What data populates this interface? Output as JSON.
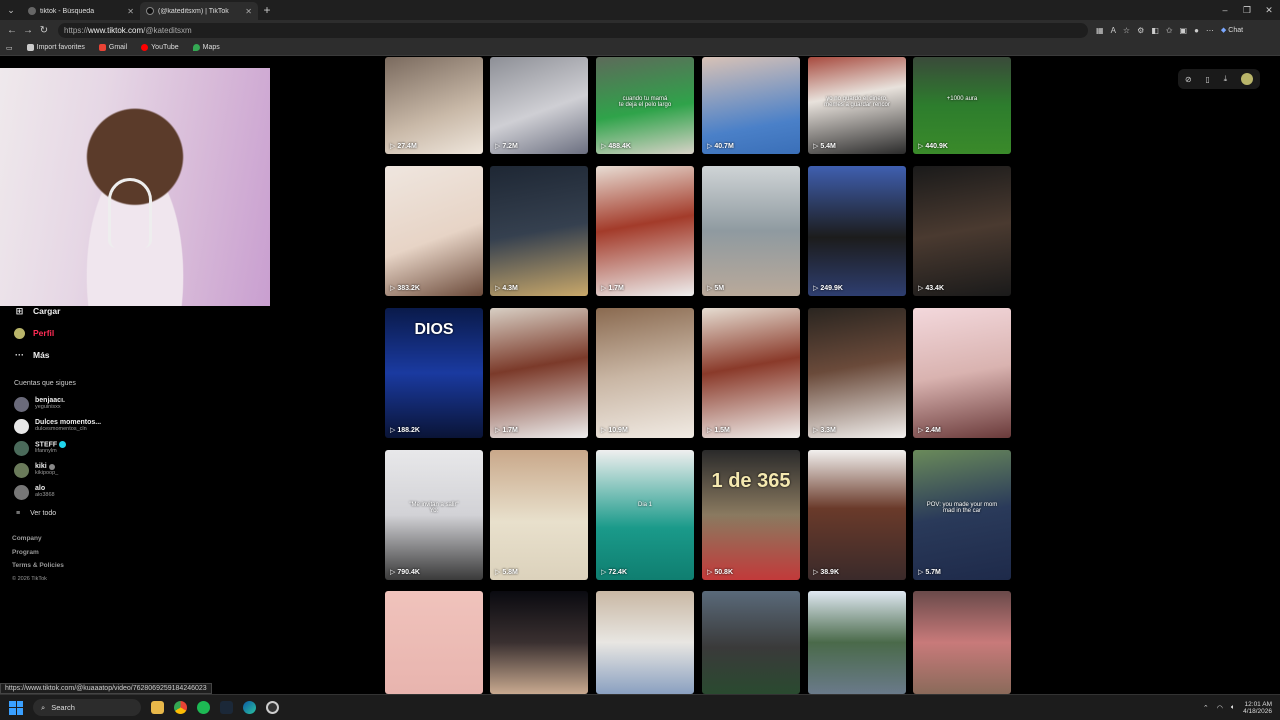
{
  "browser": {
    "tabs": [
      {
        "title": "tiktok - Búsqueda",
        "active": false
      },
      {
        "title": "(@kateditsxm) | TikTok",
        "active": true
      }
    ],
    "url_prefix": "https://",
    "url_host": "www.tiktok.com",
    "url_path": "/@kateditsxm",
    "chat_label": "Chat",
    "bookmarks": [
      "Import favorites",
      "Gmail",
      "YouTube",
      "Maps"
    ]
  },
  "sidebar": {
    "nav": [
      {
        "label": "Cargar",
        "icon": "upload-icon"
      },
      {
        "label": "Perfil",
        "icon": "profile-icon"
      },
      {
        "label": "Más",
        "icon": "more-icon"
      }
    ],
    "following_title": "Cuentas que sigues",
    "following": [
      {
        "name": "benjaacı.",
        "handle": "yeguinisxx",
        "color": "#6a6a7a",
        "badge": ""
      },
      {
        "name": "Dulces momentos...",
        "handle": "dulcesmomentos_cln",
        "color": "#e8e8e8",
        "badge": ""
      },
      {
        "name": "STEFF",
        "handle": "lifannylm",
        "color": "#4a6a5a",
        "badge": "verified"
      },
      {
        "name": "kiki",
        "handle": "kikipoop_",
        "color": "#6a7a5a",
        "badge": "muted"
      },
      {
        "name": "alo",
        "handle": "alo3868",
        "color": "#777777",
        "badge": ""
      }
    ],
    "see_all": "Ver todo",
    "footer": [
      "Company",
      "Program",
      "Terms & Policies"
    ],
    "copyright": "© 2026 TikTok"
  },
  "grid": {
    "rows": [
      [
        {
          "views": "27.4M",
          "bg": "linear-gradient(160deg,#7a6a5e,#c9b9a8 60%,#efe6dc)"
        },
        {
          "views": "7.2M",
          "bg": "linear-gradient(160deg,#8d8f96,#cfcfd4 55%,#6b6f80)"
        },
        {
          "views": "488.4K",
          "bg": "linear-gradient(170deg,#5d6a5a,#2fa34a 55%,#d8d2c8)",
          "overlay": "cuando tu mamá\nte deja el pelo largo"
        },
        {
          "views": "40.7M",
          "bg": "linear-gradient(170deg,#d8c2b6,#4a80c8 70%,#3a6fb8)"
        },
        {
          "views": "5.4M",
          "bg": "linear-gradient(170deg,#a74a3e,#e8e2dc 40%,#2b2b2b)",
          "overlay": "yo no guardo el dinero,\nmemes a guardar rencor"
        },
        {
          "views": "440.9K",
          "bg": "linear-gradient(180deg,#3a4a3a,#2d7d2d 50%,#3a8a2a)",
          "overlay": "+1000 aura"
        }
      ],
      [
        {
          "views": "383.2K",
          "bg": "linear-gradient(160deg,#efe6df,#e7d4c6 55%,#6b4a3a)"
        },
        {
          "views": "4.3M",
          "bg": "linear-gradient(170deg,#1e2734,#35404f 50%,#c9a86a)"
        },
        {
          "views": "1.7M",
          "bg": "linear-gradient(170deg,#e8ddd4,#a33b2a 45%,#eee)"
        },
        {
          "views": "5M",
          "bg": "linear-gradient(180deg,#cfd4d6,#8f9aa0 50%,#b9a99a)"
        },
        {
          "views": "249.9K",
          "bg": "linear-gradient(180deg,#3f5fb0,#1c1c1c 55%,#2e3e70)"
        },
        {
          "views": "43.4K",
          "bg": "linear-gradient(170deg,#1a1a1a,#4a3a30 50%,#1a1a1a)"
        }
      ],
      [
        {
          "views": "188.2K",
          "bg": "linear-gradient(180deg,#0a1a4a,#1a3aa0 50%,#0a1436)",
          "overlay": "DIOS"
        },
        {
          "views": "1.7M",
          "bg": "linear-gradient(170deg,#d8cfc4,#7b3a2a 45%,#eee)"
        },
        {
          "views": "10.9M",
          "bg": "linear-gradient(170deg,#8a6a50,#c9b6a4 50%,#f1ebe4)"
        },
        {
          "views": "1.5M",
          "bg": "linear-gradient(170deg,#e6ddd2,#8a3a2a 45%,#f2f0ee)"
        },
        {
          "views": "3.3M",
          "bg": "linear-gradient(170deg,#2a2520,#6a4a3a 45%,#f2f0ee)"
        },
        {
          "views": "2.4M",
          "bg": "linear-gradient(170deg,#f3d8dc,#d9b3b0 50%,#6a3a3a)"
        }
      ],
      [
        {
          "views": "790.4K",
          "bg": "linear-gradient(180deg,#e8e8ea,#d2d2d6 50%,#3a3a3a)",
          "overlay": "\"Me invitan a salir\"\nYo:"
        },
        {
          "views": "5.8M",
          "bg": "linear-gradient(180deg,#c9a88a,#e8e0cc 55%,#dcd2bc)"
        },
        {
          "views": "72.4K",
          "bg": "linear-gradient(180deg,#efefef,#1a9a8a 60%,#0f7e70)",
          "overlay": "Dia 1"
        },
        {
          "views": "50.8K",
          "bg": "linear-gradient(180deg,#2a2a2a,#8a7a60 50%,#c23a3a)",
          "overlay": "1 de 365"
        },
        {
          "views": "38.9K",
          "bg": "linear-gradient(180deg,#f2f0ee,#6a3a2a 45%,#3a2a2a)"
        },
        {
          "views": "5.7M",
          "bg": "linear-gradient(170deg,#6a8a5a,#2a3a5a 50%,#1e2a4a)",
          "overlay": "POV: you made your mom\nmad in the car"
        }
      ],
      [
        {
          "views": "",
          "bg": "linear-gradient(180deg,#f0c3bc,#e8b4ae)"
        },
        {
          "views": "",
          "bg": "linear-gradient(180deg,#0a0a10,#3a3030 50%,#c9aa90)"
        },
        {
          "views": "",
          "bg": "linear-gradient(180deg,#c9b8a4,#e8e6e2 50%,#8aa0c0)"
        },
        {
          "views": "",
          "bg": "linear-gradient(180deg,#5a6a7a,#3a3a3a 55%,#2a4a30)"
        },
        {
          "views": "",
          "bg": "linear-gradient(180deg,#dfe8f2,#4a6a4a 50%,#6a7a8a)"
        },
        {
          "views": "",
          "bg": "linear-gradient(180deg,#6a4a4a,#c87a7a 50%,#8a6a5a)"
        }
      ]
    ]
  },
  "status_url": "https://www.tiktok.com/@kuaaatop/video/7628069259184246023",
  "taskbar": {
    "search_label": "Search",
    "time": "12:01 AM",
    "date": "4/18/2026"
  }
}
